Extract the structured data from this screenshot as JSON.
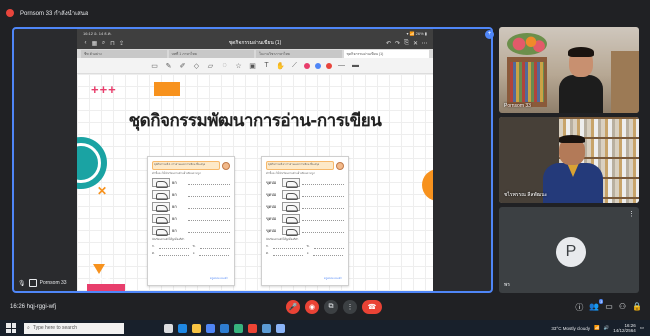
{
  "window": {
    "title": "Pornsom 33 กำลังนำเสนอ"
  },
  "tablet": {
    "status_left": "16:12  อ. 14 ธ.ค.",
    "status_right": "▾ 📶 26% ▮",
    "doc_title": "ชุดกิจกรรมอ่านเขียน (1)",
    "tabs": [
      "ชีท ตัวอย่าง",
      "บทที่ 1 ภาษาไทย",
      "ใบงานวิชาภาษาไทย",
      "ชุดกิจกรรมอ่านเขียน (1)"
    ],
    "tool_colors": [
      "#e83e6c",
      "#4f86f7",
      "#e8453c"
    ]
  },
  "slide": {
    "title": "ชุดกิจกรรมพัฒนาการอ่าน-การเขียน",
    "plus_top": "+++",
    "plus_bottom": "+++",
    "x_mark": "✕",
    "left_sheet": {
      "banner": "ชุดกิจกรรมที่ 1 การอ่านและการเขียน ชื่อ-สกุล",
      "instruction": "คำชี้แจง ให้นักเรียนอ่านคำแล้วเขียนตามรูป",
      "words": [
        "ยก",
        "ยก",
        "ยก",
        "ยก",
        "ยก"
      ],
      "question": "นักเรียนอ่านคำได้ถูกต้องกี่คำ",
      "answers": [
        "ก.",
        "ข.",
        "ค.",
        "ง."
      ],
      "footer": "ครูพรสม ทองคำ"
    },
    "right_sheet": {
      "banner": "ชุดกิจกรรมที่ 2 การอ่านและการเขียน ชื่อ-สกุล",
      "instruction": "คำชี้แจง ให้นักเรียนอ่านคำแล้วเขียนตามรูป",
      "words": [
        "ขุดบ่อ",
        "ขุดบ่อ",
        "ขุดบ่อ",
        "ขุดบ่อ",
        "ขุดบ่อ"
      ],
      "question": "นักเรียนอ่านคำได้ถูกต้องกี่คำ",
      "answers": [
        "ก.",
        "ข.",
        "ค.",
        "ง."
      ],
      "footer": "ครูพรสม ทองคำ"
    }
  },
  "presenter": {
    "name": "Pornsom 33"
  },
  "participants": [
    {
      "name": "Pornsom 33"
    },
    {
      "name": "ชไรพรรณ ลีลพัฒนะ"
    },
    {
      "initial": "P",
      "name": "พร"
    }
  ],
  "meeting": {
    "time_code": "16:26  hqj-rggi-wfj"
  },
  "taskbar": {
    "search_placeholder": "Type here to search",
    "weather": "33°C Mostly cloudy",
    "time": "16:26",
    "date": "14/12/2564"
  }
}
